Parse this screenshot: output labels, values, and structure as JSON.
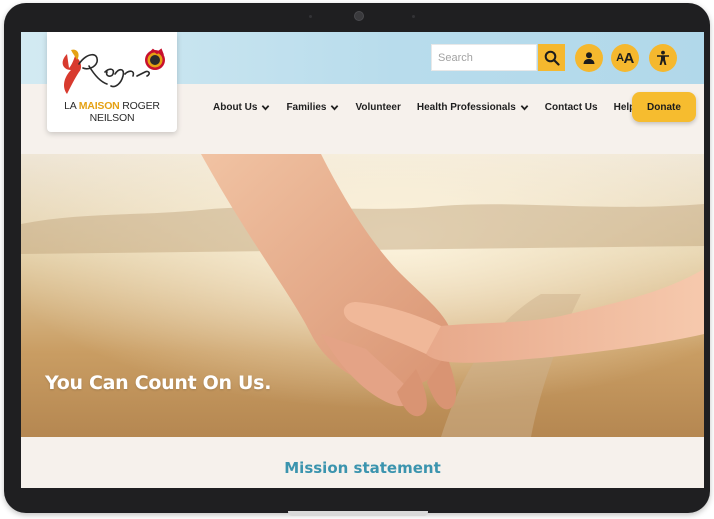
{
  "site": {
    "logo_text_pre": "LA ",
    "logo_text_accent": "MAISON",
    "logo_text_post": " ROGER NEILSON",
    "logo_signature": "Roger"
  },
  "utility": {
    "search_placeholder": "Search",
    "search_icon": "search-icon",
    "account_icon": "user-icon",
    "text_size_small": "A",
    "text_size_big": "A",
    "accessibility_icon": "accessibility-icon"
  },
  "nav": {
    "items": [
      {
        "label": "About Us",
        "has_dropdown": true
      },
      {
        "label": "Families",
        "has_dropdown": true
      },
      {
        "label": "Volunteer",
        "has_dropdown": false
      },
      {
        "label": "Health Professionals",
        "has_dropdown": true
      },
      {
        "label": "Contact Us",
        "has_dropdown": false
      },
      {
        "label": "Help",
        "has_dropdown": true
      }
    ],
    "donate_label": "Donate"
  },
  "hero": {
    "title": "You Can Count On Us."
  },
  "mission": {
    "title": "Mission statement"
  },
  "colors": {
    "accent_yellow": "#f5b82e",
    "mission_teal": "#3b94ae",
    "topbar_blue": "#b8dcec",
    "page_bg": "#f6f1ec"
  }
}
